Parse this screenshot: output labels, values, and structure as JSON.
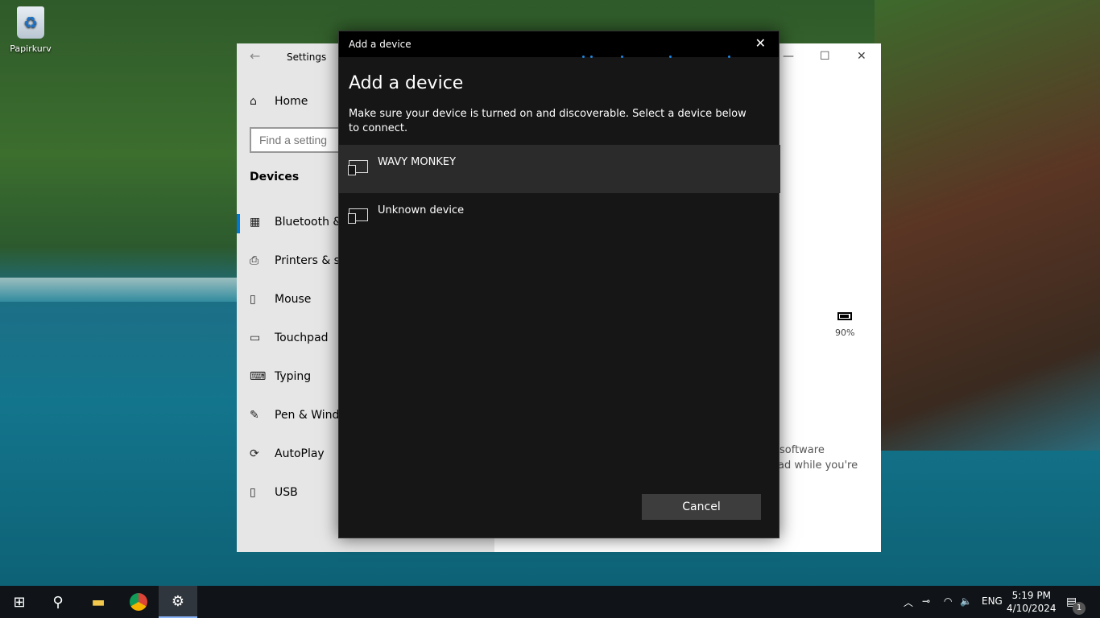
{
  "desktop": {
    "recycle_bin_label": "Papirkurv"
  },
  "settings": {
    "title": "Settings",
    "home": "Home",
    "search_placeholder": "Find a setting",
    "section": "Devices",
    "nav": [
      {
        "label": "Bluetooth & ",
        "icon": "bluetooth-devices-icon"
      },
      {
        "label": "Printers & sc",
        "icon": "printer-icon"
      },
      {
        "label": "Mouse",
        "icon": "mouse-icon"
      },
      {
        "label": "Touchpad",
        "icon": "touchpad-icon"
      },
      {
        "label": "Typing",
        "icon": "keyboard-icon"
      },
      {
        "label": "Pen & Windo",
        "icon": "pen-icon"
      },
      {
        "label": "AutoPlay",
        "icon": "autoplay-icon"
      },
      {
        "label": "USB",
        "icon": "usb-icon"
      }
    ],
    "battery_percent": "90%",
    "text_line1": "software",
    "text_line2": "ad while you're"
  },
  "dialog": {
    "titlebar": "Add a device",
    "heading": "Add a device",
    "description": "Make sure your device is turned on and discoverable. Select a device below to connect.",
    "devices": [
      {
        "name": "WAVY MONKEY",
        "selected": true
      },
      {
        "name": "Unknown device",
        "selected": false
      }
    ],
    "cancel": "Cancel"
  },
  "taskbar": {
    "language": "ENG",
    "time": "5:19 PM",
    "date": "4/10/2024",
    "notification_count": "1"
  },
  "colors": {
    "accent": "#0078d7"
  }
}
